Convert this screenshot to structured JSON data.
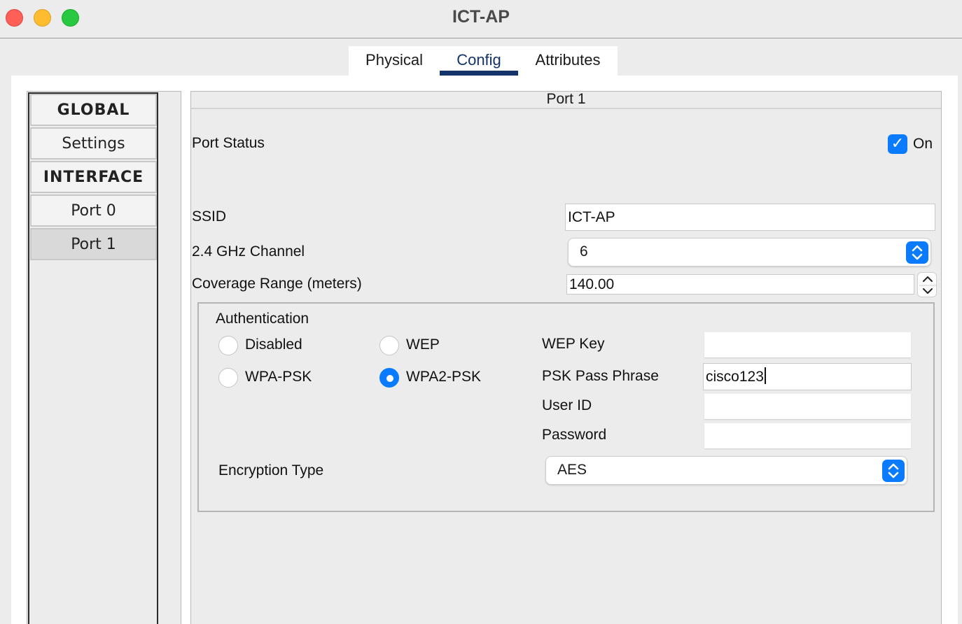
{
  "window": {
    "title": "ICT-AP"
  },
  "tabs": [
    {
      "label": "Physical"
    },
    {
      "label": "Config"
    },
    {
      "label": "Attributes"
    }
  ],
  "sidebar": {
    "items": [
      {
        "label": "GLOBAL",
        "type": "header"
      },
      {
        "label": "Settings",
        "type": "item"
      },
      {
        "label": "INTERFACE",
        "type": "header"
      },
      {
        "label": "Port 0",
        "type": "item"
      },
      {
        "label": "Port 1",
        "type": "item",
        "selected": true
      }
    ]
  },
  "panel": {
    "title": "Port 1",
    "port_status": {
      "label": "Port Status",
      "checkbox_label": "On",
      "checked": true
    },
    "ssid": {
      "label": "SSID",
      "value": "ICT-AP"
    },
    "channel": {
      "label": "2.4 GHz Channel",
      "value": "6"
    },
    "coverage": {
      "label": "Coverage Range (meters)",
      "value": "140.00"
    },
    "authentication": {
      "label": "Authentication",
      "options": [
        {
          "label": "Disabled",
          "selected": false
        },
        {
          "label": "WEP",
          "selected": false
        },
        {
          "label": "WPA-PSK",
          "selected": false
        },
        {
          "label": "WPA2-PSK",
          "selected": true
        }
      ],
      "wep_key": {
        "label": "WEP Key",
        "value": ""
      },
      "psk_pass_phrase": {
        "label": "PSK Pass Phrase",
        "value": "cisco123"
      },
      "user_id": {
        "label": "User ID",
        "value": ""
      },
      "password": {
        "label": "Password",
        "value": ""
      }
    },
    "encryption": {
      "label": "Encryption Type",
      "value": "AES"
    }
  },
  "colors": {
    "accent": "#0a7bff",
    "tab_active": "#14336b"
  }
}
